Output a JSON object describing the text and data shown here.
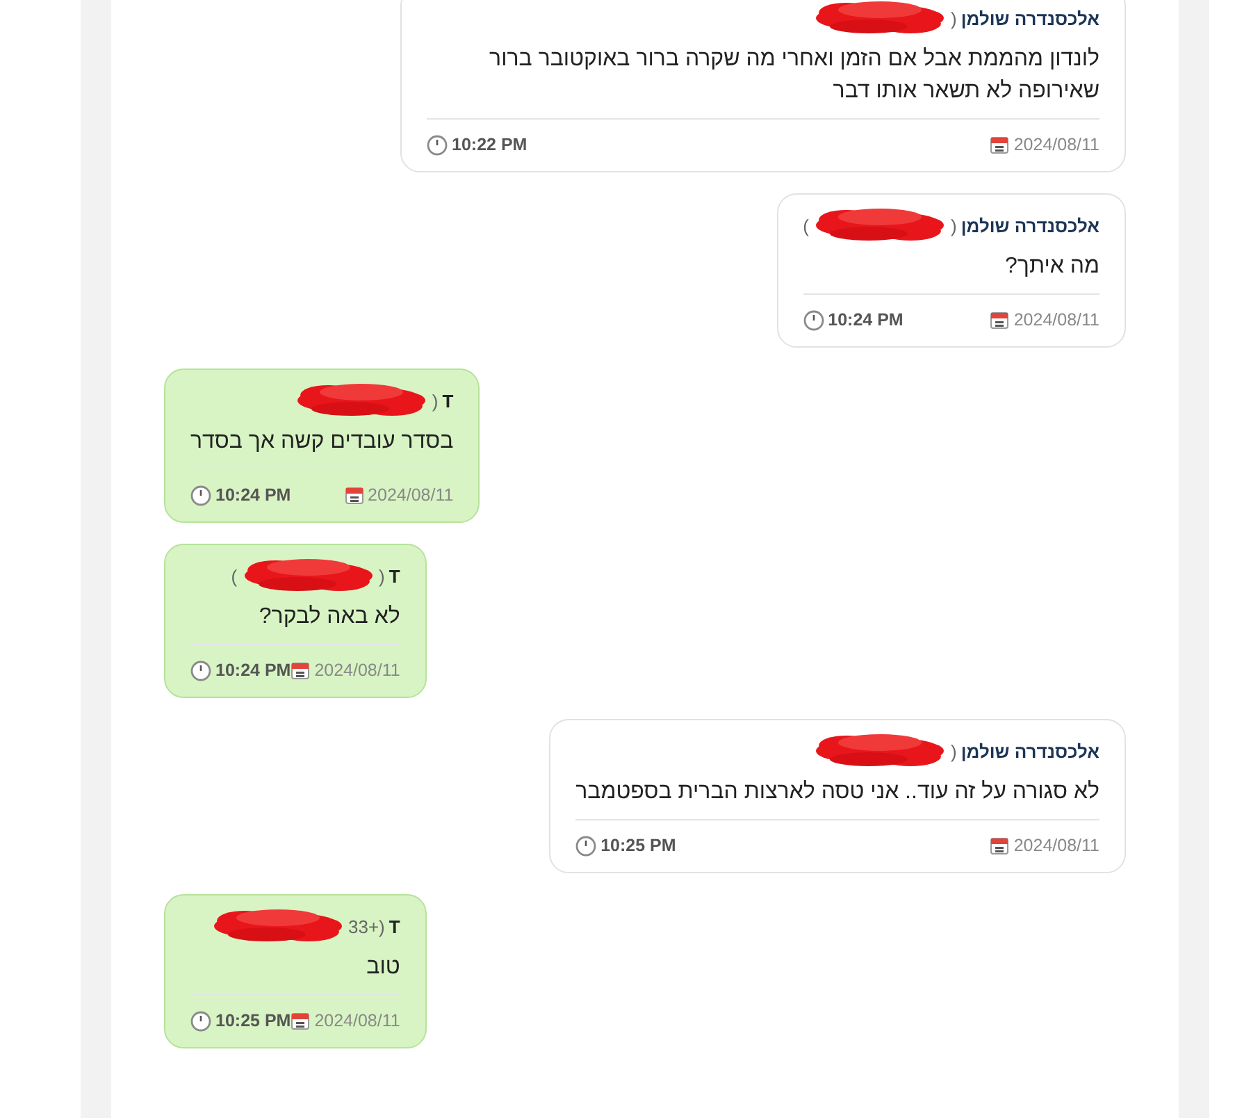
{
  "messages": [
    {
      "kind": "outgoing",
      "sender": "אלכסנדרה שולמן",
      "phone": "(",
      "redacted": true,
      "text": "לונדון מהממת אבל אם הזמן ואחרי מה שקרה ברור באוקטובר ברור שאירופה לא תשאר אותו דבר",
      "date": "2024/08/11",
      "time": "10:22 PM"
    },
    {
      "kind": "outgoing",
      "sender": "אלכסנדרה שולמן",
      "phone": "(",
      "phone_tail": ")",
      "redacted": true,
      "text": "מה איתך?",
      "date": "2024/08/11",
      "time": "10:24 PM"
    },
    {
      "kind": "incoming",
      "sender": "T",
      "phone": "(",
      "redacted": true,
      "text": "בסדר עובדים קשה אך בסדר",
      "date": "2024/08/11",
      "time": "10:24 PM"
    },
    {
      "kind": "incoming",
      "sender": "T",
      "phone": "(",
      "phone_tail": ")",
      "redacted": true,
      "text": "לא באה לבקר?",
      "date": "2024/08/11",
      "time": "10:24 PM"
    },
    {
      "kind": "outgoing",
      "sender": "אלכסנדרה שולמן",
      "phone": "(",
      "redacted": true,
      "text": "לא סגורה על זה עוד.. אני טסה לארצות הברית בספטמבר",
      "date": "2024/08/11",
      "time": "10:25 PM"
    },
    {
      "kind": "incoming",
      "sender": "T",
      "phone": "(+33",
      "redacted": true,
      "text": "טוב",
      "date": "2024/08/11",
      "time": "10:25 PM"
    }
  ]
}
